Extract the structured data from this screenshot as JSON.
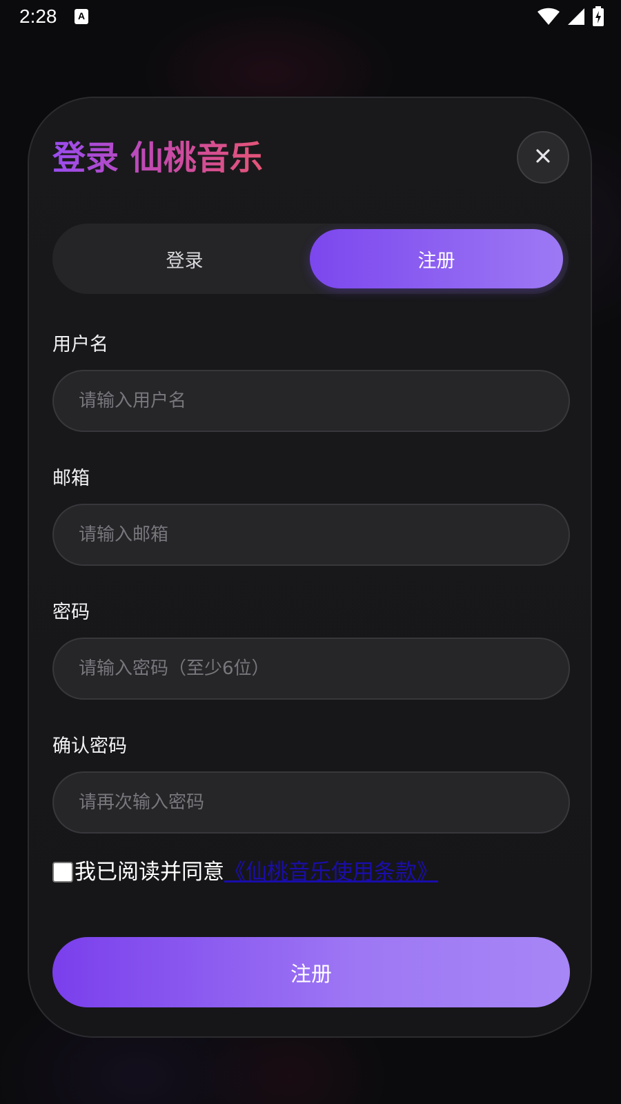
{
  "status_bar": {
    "time": "2:28",
    "notification_icon": "A",
    "icons": [
      "wifi-icon",
      "signal-icon",
      "battery-charging-icon"
    ]
  },
  "dialog": {
    "title": "登录 仙桃音乐",
    "close_icon": "close-icon",
    "tabs": [
      {
        "label": "登录",
        "selected": false
      },
      {
        "label": "注册",
        "selected": true
      }
    ],
    "fields": {
      "username": {
        "label": "用户名",
        "placeholder": "请输入用户名",
        "value": ""
      },
      "email": {
        "label": "邮箱",
        "placeholder": "请输入邮箱",
        "value": ""
      },
      "password": {
        "label": "密码",
        "placeholder": "请输入密码（至少6位）",
        "value": ""
      },
      "confirm_password": {
        "label": "确认密码",
        "placeholder": "请再次输入密码",
        "value": ""
      }
    },
    "agreement": {
      "checked": false,
      "text": "我已阅读并同意",
      "link_text": "《仙桃音乐使用条款》"
    },
    "submit_label": "注册"
  },
  "colors": {
    "accent_start": "#7a3fec",
    "accent_end": "#a786f6",
    "title_gradient": [
      "#9a4cf0",
      "#e55477"
    ],
    "link": "#1a0dab",
    "card_bg": "#19191b",
    "page_bg": "#0b0b0d"
  }
}
